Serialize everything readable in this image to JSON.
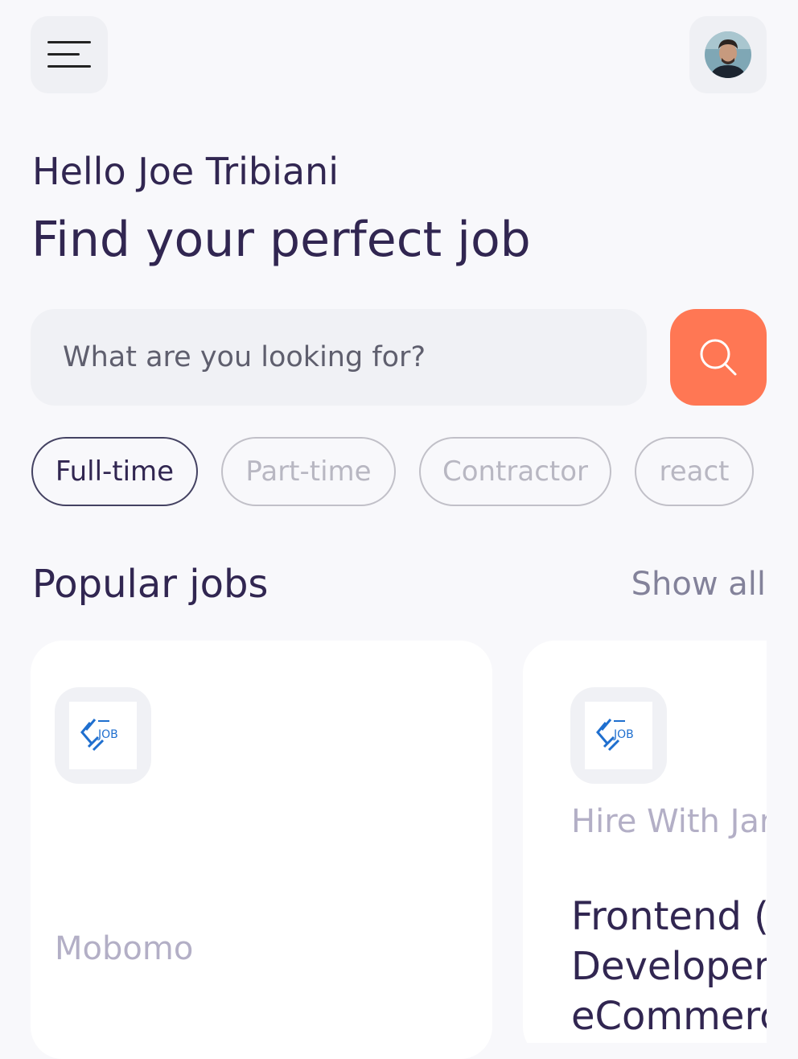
{
  "header": {
    "menu_icon": "menu-icon",
    "avatar": "profile-photo"
  },
  "welcome": {
    "greeting": "Hello Joe Tribiani",
    "headline": "Find your perfect job"
  },
  "search": {
    "placeholder": "What are you looking for?",
    "button_icon": "search-icon"
  },
  "job_types": [
    {
      "label": "Full-time",
      "active": true
    },
    {
      "label": "Part-time",
      "active": false
    },
    {
      "label": "Contractor",
      "active": false
    },
    {
      "label": "react",
      "active": false
    }
  ],
  "popular": {
    "title": "Popular jobs",
    "show_all": "Show all",
    "cards": [
      {
        "logo_text": "JOB",
        "company": "Mobomo",
        "title": ""
      },
      {
        "logo_text": "JOB",
        "company": "Hire With Jar",
        "title": "Frontend (\nDeveloper\neCommerc"
      }
    ]
  },
  "colors": {
    "background": "#f8f8fb",
    "primary_text": "#312651",
    "accent": "#ff7754",
    "logo_blue": "#1f6fcf"
  }
}
